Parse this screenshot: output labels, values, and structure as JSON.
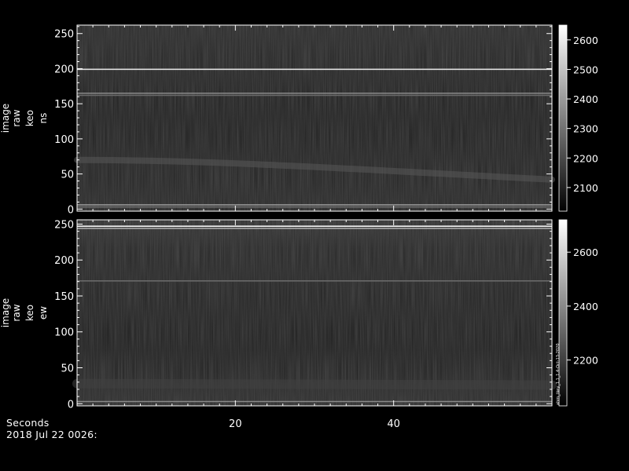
{
  "chart_data": [
    {
      "type": "heatmap",
      "ylabel_lines": [
        "image",
        "raw",
        "keo",
        "ns"
      ],
      "x_ticks": [
        20,
        40
      ],
      "xlim": [
        0,
        60
      ],
      "y_ticks": [
        0,
        50,
        100,
        150,
        200,
        250
      ],
      "ylim": [
        -3,
        262
      ],
      "colorbar_ticks": [
        2100,
        2200,
        2300,
        2400,
        2500,
        2600
      ],
      "colorbar_range": [
        2020,
        2650
      ],
      "bright_rows": [
        {
          "y": 199,
          "level": 0.85
        },
        {
          "y": 165,
          "level": 0.45
        },
        {
          "y": 162,
          "level": 0.3
        },
        {
          "y": 6,
          "level": 0.5
        },
        {
          "y": 3,
          "level": 0.35
        }
      ],
      "bands": [
        {
          "y_start": 70,
          "y_end": 42,
          "width": 8,
          "level": 0.22
        }
      ]
    },
    {
      "type": "heatmap",
      "ylabel_lines": [
        "image",
        "raw",
        "keo",
        "ew"
      ],
      "x_ticks": [
        20,
        40
      ],
      "xlim": [
        0,
        60
      ],
      "y_ticks": [
        0,
        50,
        100,
        150,
        200,
        250
      ],
      "ylim": [
        -3,
        256
      ],
      "colorbar_ticks": [
        2200,
        2400,
        2600
      ],
      "colorbar_range": [
        2030,
        2720
      ],
      "bright_rows": [
        {
          "y": 247,
          "level": 0.95
        },
        {
          "y": 244,
          "level": 0.6
        },
        {
          "y": 171,
          "level": 0.3
        },
        {
          "y": 3,
          "level": 0.45
        }
      ],
      "bands": [
        {
          "y_start": 28,
          "y_end": 26,
          "width": 12,
          "level": 0.12
        }
      ],
      "side_note": "ahm_tkey_1.1_1.4-Oct-13-2020"
    }
  ],
  "footer": {
    "xunit": "Seconds",
    "date": "2018 Jul 22 0026:"
  }
}
